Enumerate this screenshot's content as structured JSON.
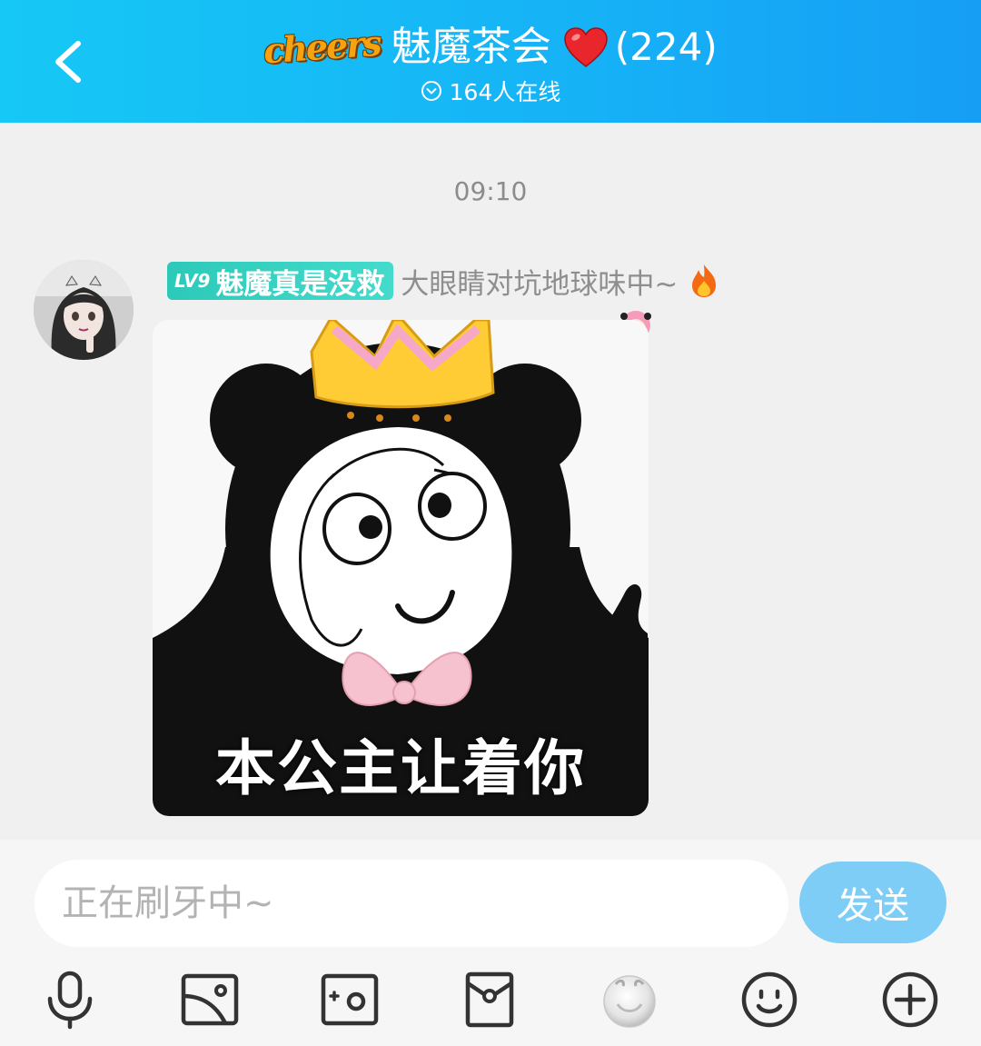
{
  "header": {
    "logo_text": "cheers",
    "group_name": "魅魔茶会",
    "group_count": "(224)",
    "online_text": "164人在线"
  },
  "chat": {
    "timestamp": "09:10",
    "message": {
      "level": "LV9",
      "nickname": "魅魔真是没救",
      "title": "大眼睛对坑地球味中~",
      "sticker_caption": "本公主让着你"
    }
  },
  "input": {
    "placeholder": "正在刷牙中~",
    "send_label": "发送"
  },
  "toolbar": {
    "icons": [
      "microphone-icon",
      "image-icon",
      "camera-icon",
      "red-packet-icon",
      "tickle-icon",
      "emoji-icon",
      "plus-icon"
    ]
  },
  "colors": {
    "header_gradient_start": "#16c8f5",
    "header_gradient_end": "#169ef5",
    "level_badge": "#2dc9b8",
    "send_button": "#7ecdf6",
    "background": "#f0f0f0"
  }
}
